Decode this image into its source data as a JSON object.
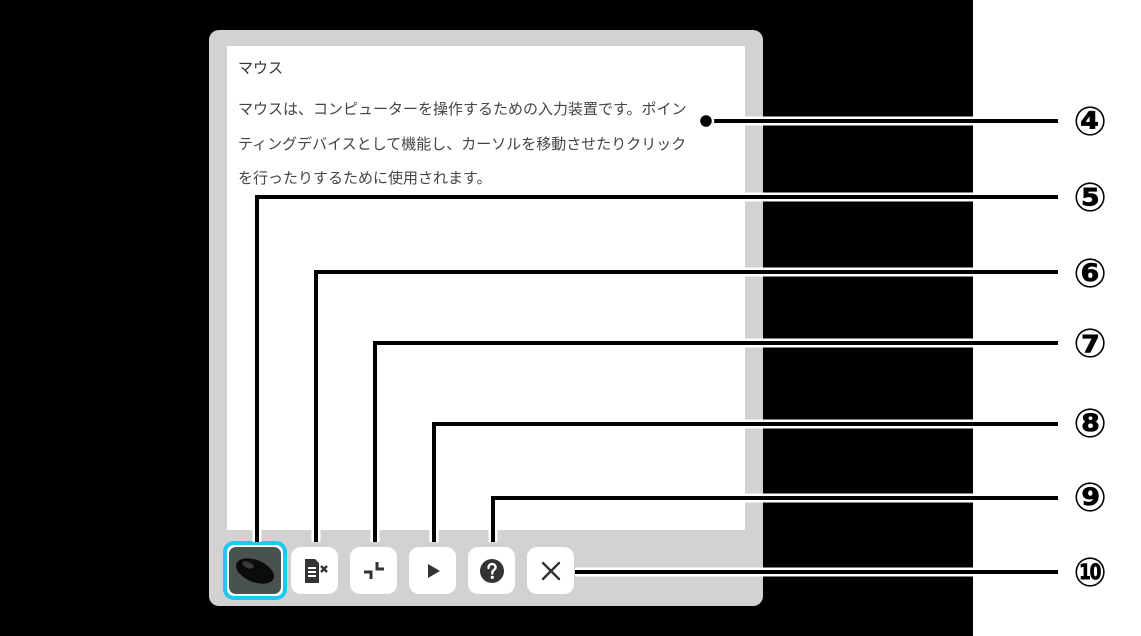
{
  "popup": {
    "title": "マウス",
    "body_lines": [
      "マウスは、コンピューターを操作するための入力装置です。ポイン",
      "ティングデバイスとして機能し、カーソルを移動させたりクリック",
      "を行ったりするために使用されます。"
    ]
  },
  "toolbar": {
    "buttons": [
      {
        "name": "mouse-thumbnail",
        "icon": "mouse-image"
      },
      {
        "name": "mute-speech",
        "icon": "text-mute-icon"
      },
      {
        "name": "shrink",
        "icon": "shrink-icon"
      },
      {
        "name": "play",
        "icon": "play-icon"
      },
      {
        "name": "help",
        "icon": "help-icon"
      },
      {
        "name": "close",
        "icon": "close-icon"
      }
    ]
  },
  "callouts": [
    "④",
    "⑤",
    "⑥",
    "⑦",
    "⑧",
    "⑨",
    "⑩"
  ],
  "colors": {
    "background": "#000000",
    "panel": "#d2d2d2",
    "thumbnail_border": "#1ec8ee",
    "icon": "#333333"
  }
}
